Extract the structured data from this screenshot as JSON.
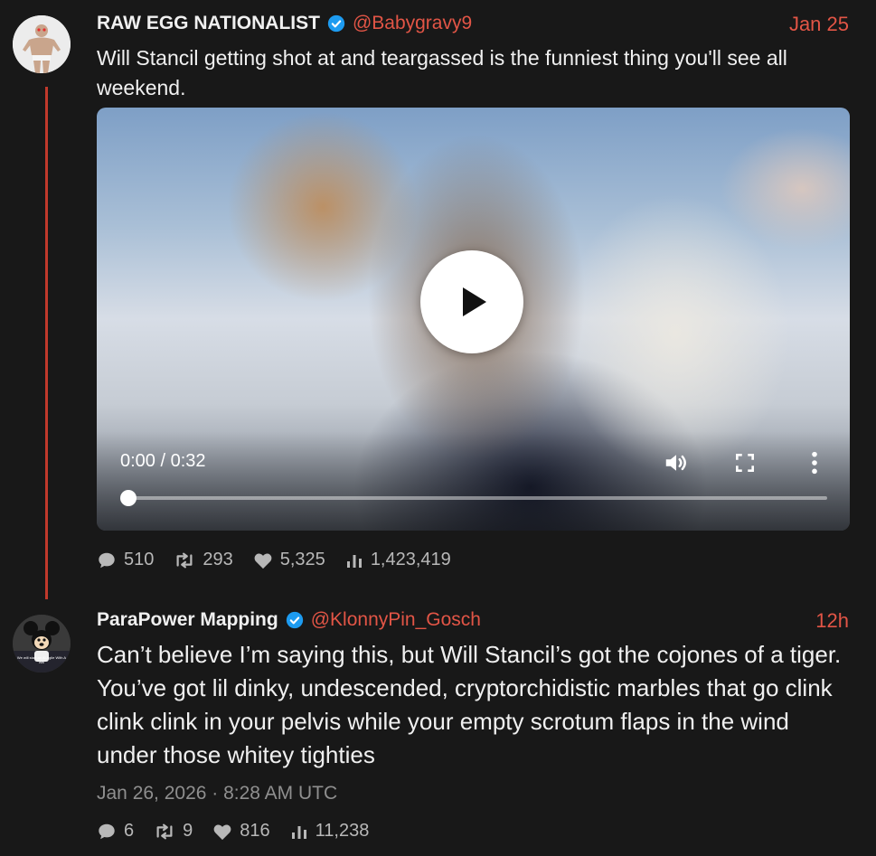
{
  "tweet1": {
    "display_name": "RAW EGG NATIONALIST",
    "handle": "@Babygravy9",
    "date": "Jan 25",
    "text": "Will Stancil getting shot at and teargassed is the funniest thing you'll see all weekend.",
    "video": {
      "time": "0:00 / 0:32",
      "progress": 0,
      "icons": [
        "play-icon",
        "volume-icon",
        "fullscreen-icon",
        "more-options-icon"
      ]
    },
    "stats": {
      "replies": "510",
      "retweets": "293",
      "likes": "5,325",
      "views": "1,423,419"
    }
  },
  "tweet2": {
    "display_name": "ParaPower Mapping",
    "handle": "@KlonnyPin_Gosch",
    "date": "12h",
    "text": "Can’t believe I’m saying this, but Will Stancil’s got the cojones of a tiger. You’ve got lil dinky, undescended, cryptorchidistic marbles that go clink clink clink in your pelvis while your empty scrotum flaps in the wind under those whitey tighties",
    "timestamp": "Jan 26, 2026 · 8:28 AM UTC",
    "avatar_caption": "We will start an AI Agile With A Will",
    "stats": {
      "replies": "6",
      "retweets": "9",
      "likes": "816",
      "views": "11,238"
    }
  },
  "colors": {
    "background": "#181818",
    "accent": "#e25546",
    "thread_line": "#c0392b",
    "verified": "#1d9bf0",
    "muted": "#b8b8b8"
  }
}
